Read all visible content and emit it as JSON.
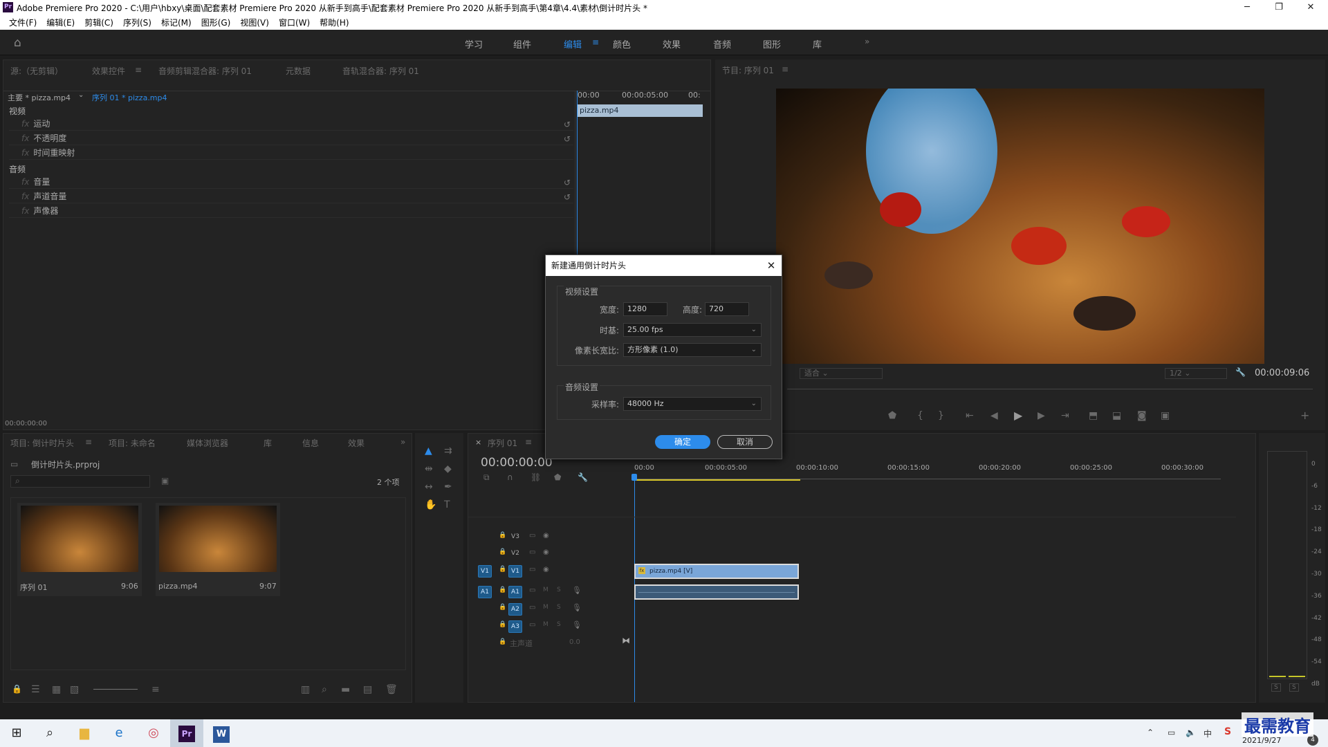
{
  "window": {
    "title": "Adobe Premiere Pro 2020 - C:\\用户\\hbxy\\桌面\\配套素材 Premiere Pro 2020 从新手到高手\\配套素材 Premiere Pro 2020 从新手到高手\\第4章\\4.4\\素材\\倒计时片头 *",
    "app_badge": "Pr"
  },
  "menu": [
    "文件(F)",
    "编辑(E)",
    "剪辑(C)",
    "序列(S)",
    "标记(M)",
    "图形(G)",
    "视图(V)",
    "窗口(W)",
    "帮助(H)"
  ],
  "workspaces": [
    "学习",
    "组件",
    "编辑",
    "颜色",
    "效果",
    "音频",
    "图形",
    "库"
  ],
  "workspace_active": "编辑",
  "effects_panel": {
    "tabs": [
      "源:（无剪辑）",
      "效果控件",
      "音频剪辑混合器: 序列 01",
      "元数据",
      "音轨混合器: 序列 01"
    ],
    "master": "主要 * pizza.mp4",
    "sequence": "序列 01 * pizza.mp4",
    "video_label": "视频",
    "audio_label": "音频",
    "video_rows": [
      "运动",
      "不透明度",
      "时间重映射"
    ],
    "audio_rows": [
      "音量",
      "声道音量",
      "声像器"
    ],
    "ruler": [
      "00:00",
      "00:00:05:00",
      "00:"
    ],
    "clip": "pizza.mp4",
    "timecode": "00:00:00:00"
  },
  "program": {
    "title": "节目: 序列 01",
    "fit": "适合",
    "quality": "1/2",
    "timecode": "00:00:09:06"
  },
  "project": {
    "tabs": [
      "项目: 倒计时片头",
      "项目: 未命名",
      "媒体浏览器",
      "库",
      "信息",
      "效果"
    ],
    "file": "倒计时片头.prproj",
    "count": "2 个项",
    "items": [
      {
        "name": "序列 01",
        "dur": "9:06"
      },
      {
        "name": "pizza.mp4",
        "dur": "9:07"
      }
    ]
  },
  "timeline": {
    "tab": "序列 01",
    "timecode": "00:00:00:00",
    "ruler": [
      "00:00",
      "00:00:05:00",
      "00:00:10:00",
      "00:00:15:00",
      "00:00:20:00",
      "00:00:25:00",
      "00:00:30:00"
    ],
    "video_tracks": [
      "V3",
      "V2",
      "V1"
    ],
    "audio_tracks": [
      "A1",
      "A2",
      "A3"
    ],
    "src_v": "V1",
    "src_a": "A1",
    "master_label": "主声道",
    "master_val": "0.0",
    "clip_video": "pizza.mp4 [V]",
    "ms": [
      "M",
      "S"
    ]
  },
  "meter": {
    "ticks": [
      "0",
      "-6",
      "-12",
      "-18",
      "-24",
      "-30",
      "-36",
      "-42",
      "-48",
      "-54",
      "dB"
    ],
    "solo": [
      "S",
      "S"
    ]
  },
  "dialog": {
    "title": "新建通用倒计时片头",
    "video_group": "视频设置",
    "width_label": "宽度:",
    "width": "1280",
    "height_label": "高度:",
    "height": "720",
    "timebase_label": "时基:",
    "timebase": "25.00 fps",
    "par_label": "像素长宽比:",
    "par": "方形像素 (1.0)",
    "audio_group": "音频设置",
    "rate_label": "采样率:",
    "rate": "48000 Hz",
    "ok": "确定",
    "cancel": "取消"
  },
  "taskbar": {
    "date": "2021/9/27",
    "ime": "中",
    "watermark": "最需教育",
    "tray_badge": "4"
  },
  "colors": {
    "accent": "#2d8ceb",
    "clip_video": "#7aa6d8",
    "selected_track": "#1e5a8a"
  }
}
